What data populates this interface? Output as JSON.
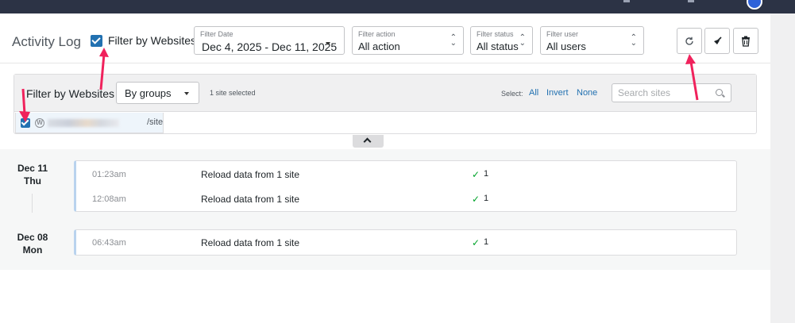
{
  "header": {
    "title": "Activity Log",
    "filter_by_websites_label": "Filter by Websites"
  },
  "filters": {
    "date": {
      "label": "Filter Date",
      "value": "Dec 4, 2025 - Dec 11, 2025"
    },
    "action": {
      "label": "Filter action",
      "value": "All action"
    },
    "status": {
      "label": "Filter status",
      "value": "All status"
    },
    "user": {
      "label": "Filter user",
      "value": "All users"
    }
  },
  "toolbar": {
    "icons": [
      "reload-icon",
      "clear-icon",
      "trash-icon"
    ]
  },
  "site_filter": {
    "label": "Filter by Websites",
    "group_mode": "By groups",
    "selected_count": "1 site selected",
    "select_label": "Select:",
    "select_all": "All",
    "select_invert": "Invert",
    "select_none": "None",
    "search_placeholder": "Search sites",
    "sites": [
      {
        "url_suffix": "/site",
        "checked": true
      }
    ]
  },
  "log": {
    "days": [
      {
        "month_day": "Dec 11",
        "weekday": "Thu",
        "entries": [
          {
            "time": "01:23am",
            "text": "Reload data from 1 site",
            "count": "1"
          },
          {
            "time": "12:08am",
            "text": "Reload data from 1 site",
            "count": "1"
          }
        ]
      },
      {
        "month_day": "Dec 08",
        "weekday": "Mon",
        "entries": [
          {
            "time": "06:43am",
            "text": "Reload data from 1 site",
            "count": "1"
          }
        ]
      }
    ]
  },
  "colors": {
    "accent": "#2271b1",
    "annotation_arrow": "#f0225c",
    "success": "#00a32a",
    "topbar": "#2c3345"
  }
}
